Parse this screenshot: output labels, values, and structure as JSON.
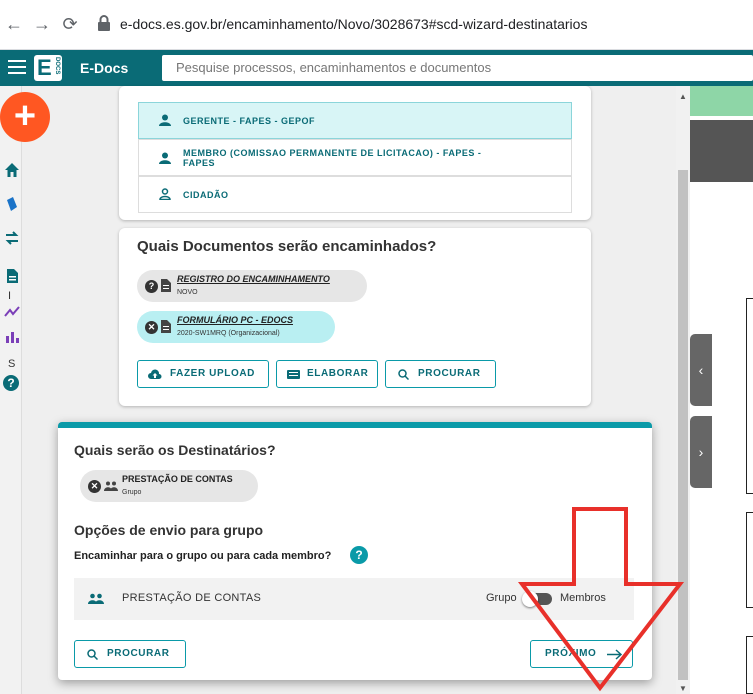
{
  "browser": {
    "url": "e-docs.es.gov.br/encaminhamento/Novo/3028673#scd-wizard-destinatarios"
  },
  "app": {
    "brand": "E-Docs",
    "logo_letter": "E",
    "logo_small": "DOCS",
    "search_placeholder": "Pesquise processos, encaminhamentos e documentos"
  },
  "sidebar": {
    "plus": "+",
    "text_i": "I",
    "text_s": "S",
    "help": "?"
  },
  "senders": [
    {
      "label": "GERENTE - FAPES - GEPOF",
      "selected": true
    },
    {
      "label_line1": "MEMBRO (COMISSAO PERMANENTE DE LICITACAO) - FAPES -",
      "label_line2": "FAPES",
      "selected": false
    },
    {
      "label": "CIDADÃO",
      "selected": false
    }
  ],
  "documents": {
    "title": "Quais Documentos serão encaminhados?",
    "items": [
      {
        "name": "REGISTRO DO ENCAMINHAMENTO",
        "sub": "NOVO",
        "icon": "help-circle-icon"
      },
      {
        "name": "FORMULÁRIO PC - EDOCS",
        "sub": "2020-SW1MRQ (Organizacional)",
        "icon": "remove-circle-icon"
      }
    ],
    "buttons": {
      "upload": "FAZER UPLOAD",
      "elaborar": "ELABORAR",
      "procurar": "PROCURAR"
    }
  },
  "recipients": {
    "title": "Quais serão os Destinatários?",
    "chip": {
      "name": "PRESTAÇÃO DE CONTAS",
      "sub": "Grupo"
    },
    "options_title": "Opções de envio para grupo",
    "question": "Encaminhar para o grupo ou para cada membro?",
    "help": "?",
    "row": {
      "name": "PRESTAÇÃO DE CONTAS",
      "left_option": "Grupo",
      "right_option": "Membros",
      "selected": "Grupo"
    },
    "procurar": "PROCURAR",
    "proximo": "PRÓXIMO"
  },
  "colors": {
    "accent": "#0a9aa8",
    "header": "#0a6b76",
    "plus": "#ff5722",
    "arrow": "#e8302a"
  }
}
